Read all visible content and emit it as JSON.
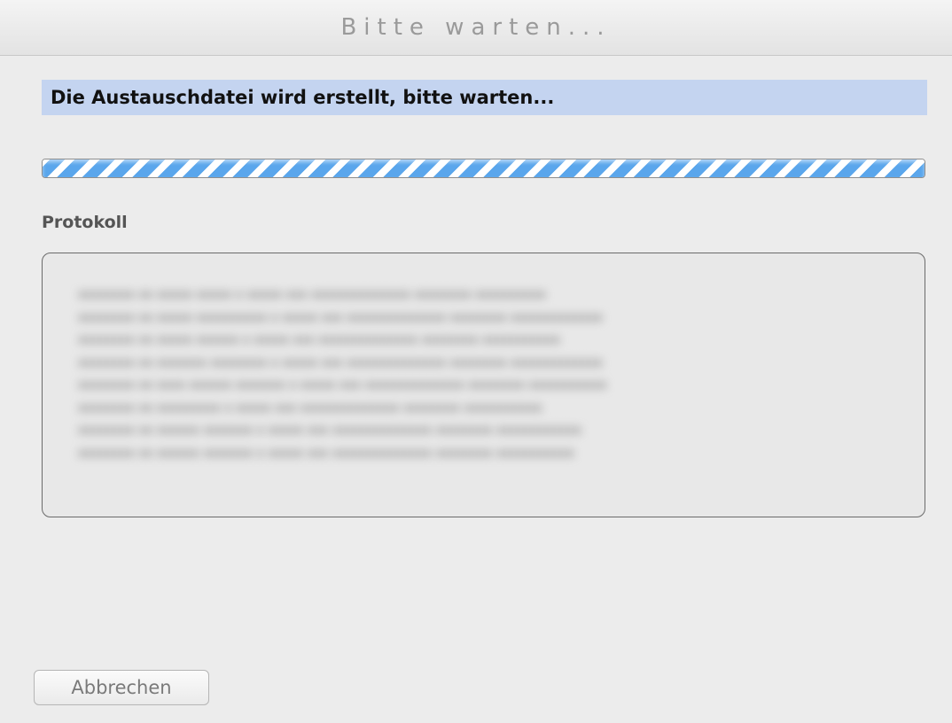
{
  "window": {
    "title": "Bitte warten..."
  },
  "status": {
    "message": "Die Austauschdatei wird erstellt, bitte warten..."
  },
  "progress": {
    "state": "indeterminate"
  },
  "log": {
    "label": "Protokoll",
    "blurred": true
  },
  "buttons": {
    "cancel_label": "Abbrechen"
  },
  "colors": {
    "status_highlight": "#c4d4f0",
    "progress_stripe": "#5aa6ec"
  }
}
